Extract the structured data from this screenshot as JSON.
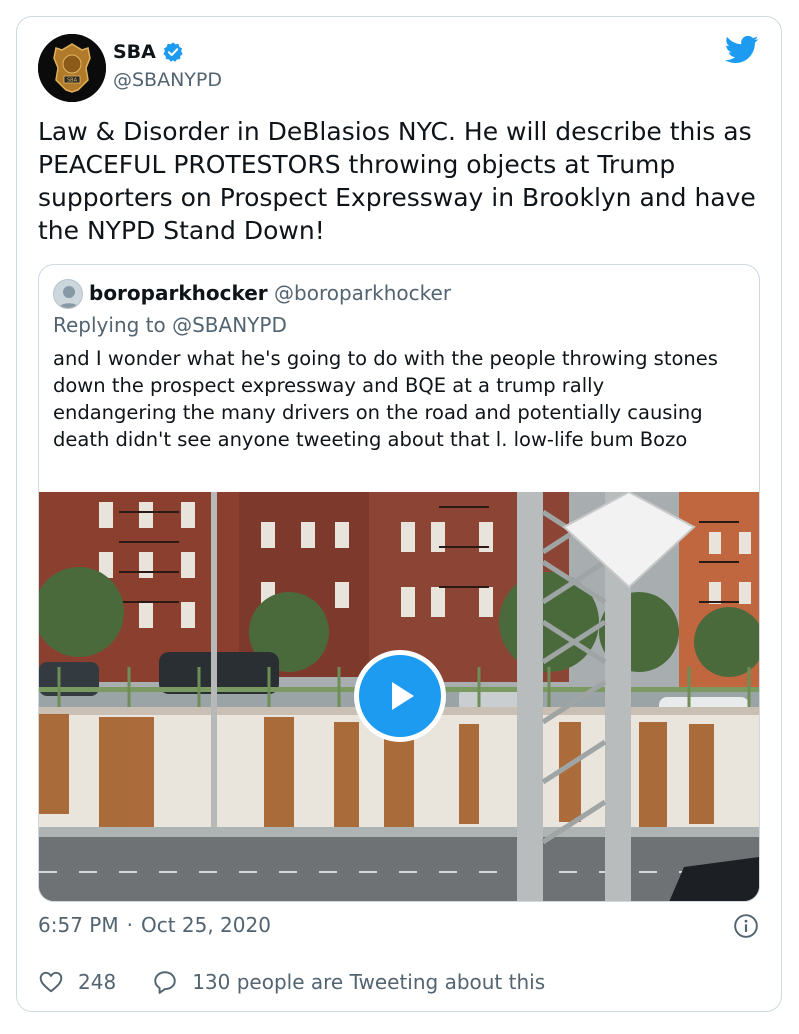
{
  "tweet": {
    "author_name": "SBA",
    "author_handle": "@SBANYPD",
    "badge_text": "SBA",
    "text": "Law & Disorder in DeBlasios NYC. He will describe this as PEACEFUL PROTESTORS throwing objects at Trump supporters on Prospect Expressway in Brooklyn and have the NYPD Stand Down!",
    "timestamp": "6:57 PM",
    "separator": "·",
    "date": "Oct 25, 2020",
    "likes": "248",
    "conversation_text": "130 people are Tweeting about this"
  },
  "quote": {
    "author_name": "boroparkhocker",
    "author_handle": "@boroparkhocker",
    "replying_to": "Replying to @SBANYPD",
    "text": "and I wonder what he's going to do with the people throwing stones down the prospect expressway and BQE at a trump rally endangering the many drivers on the road and potentially causing death didn't see anyone tweeting about that l. low-life bum Bozo"
  },
  "icons": {
    "verified": "verified-badge-icon",
    "bird": "twitter-bird-icon",
    "info": "info-icon",
    "like": "heart-icon",
    "reply": "speech-bubble-icon",
    "play": "play-icon"
  },
  "colors": {
    "accent": "#1d9bf0",
    "text_primary": "#0f1419",
    "text_secondary": "#536471",
    "border": "#cfd9de"
  }
}
